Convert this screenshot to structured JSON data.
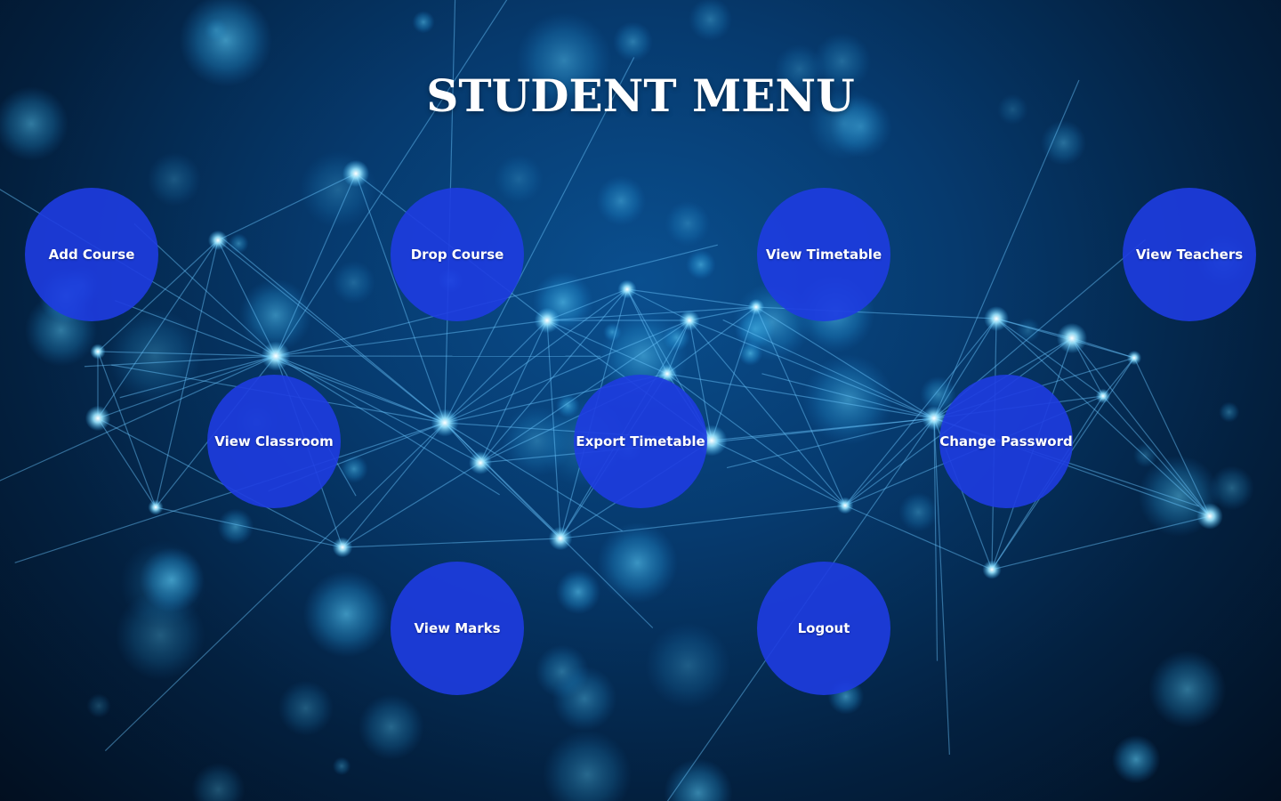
{
  "page": {
    "title": "STUDENT MENU"
  },
  "theme": {
    "button_color": "#1e3ce1",
    "title_color": "#ffffff",
    "background": "blue network / plexus bokeh"
  },
  "menu": {
    "add_course": "Add Course",
    "drop_course": "Drop Course",
    "view_timetable": "View Timetable",
    "view_teachers": "View Teachers",
    "view_classroom": "View Classroom",
    "export_timetable": "Export Timetable",
    "change_password": "Change Password",
    "view_marks": "View Marks",
    "logout": "Logout"
  }
}
